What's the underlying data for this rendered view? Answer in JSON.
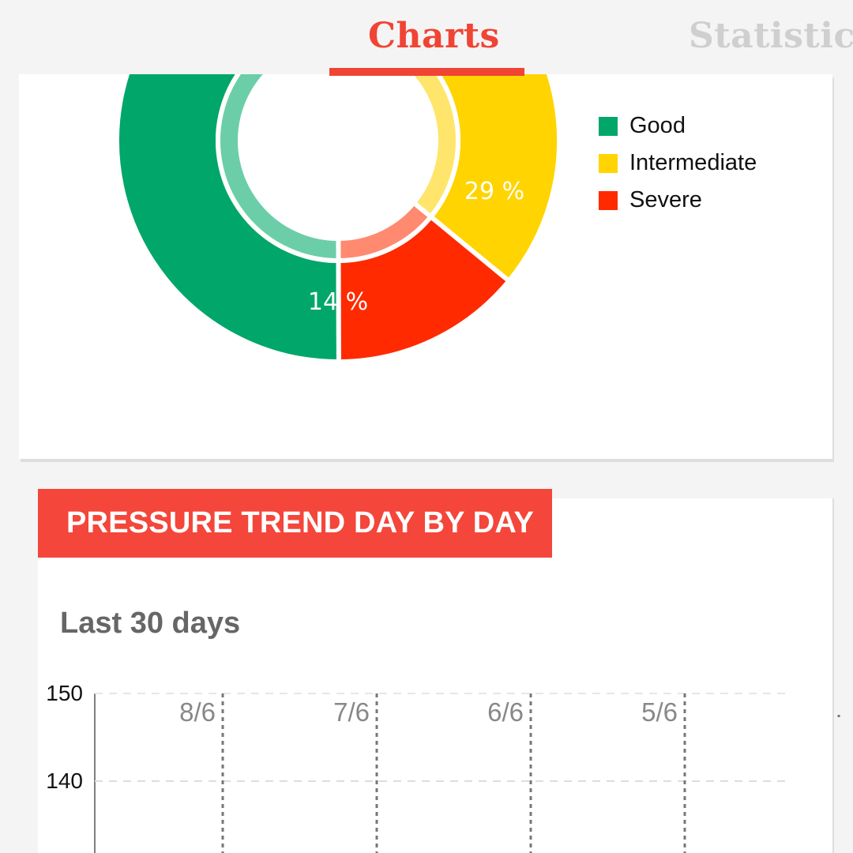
{
  "tabs": [
    {
      "label": "Charts",
      "active": true
    },
    {
      "label": "Statistics",
      "active": false
    }
  ],
  "colors": {
    "accent": "#f04434",
    "good": "#00a66a",
    "intermediate": "#ffd400",
    "severe": "#ff2a00"
  },
  "distribution": {
    "legend": [
      {
        "label": "Good",
        "color": "#00a66a"
      },
      {
        "label": "Intermediate",
        "color": "#ffd400"
      },
      {
        "label": "Severe",
        "color": "#ff2a00"
      }
    ],
    "labels": {
      "intermediate": "29 %",
      "severe": "14 %"
    }
  },
  "trend": {
    "banner": "PRESSURE TREND DAY BY DAY",
    "period": "Last 30 days"
  },
  "chart_data": [
    {
      "type": "pie",
      "title": "",
      "categories": [
        "Good",
        "Intermediate",
        "Severe"
      ],
      "values": [
        57,
        29,
        14
      ],
      "labels": [
        "",
        "29 %",
        "14 %"
      ],
      "donut": true,
      "legend": "right"
    },
    {
      "type": "line",
      "title": "",
      "xlabel": "",
      "ylabel": "",
      "y_ticks": [
        "150",
        "140"
      ],
      "x_ticks": [
        "8/6",
        "7/6",
        "6/6",
        "5/6"
      ],
      "ylim_visible": [
        130,
        150
      ],
      "grid": true,
      "series": []
    }
  ]
}
